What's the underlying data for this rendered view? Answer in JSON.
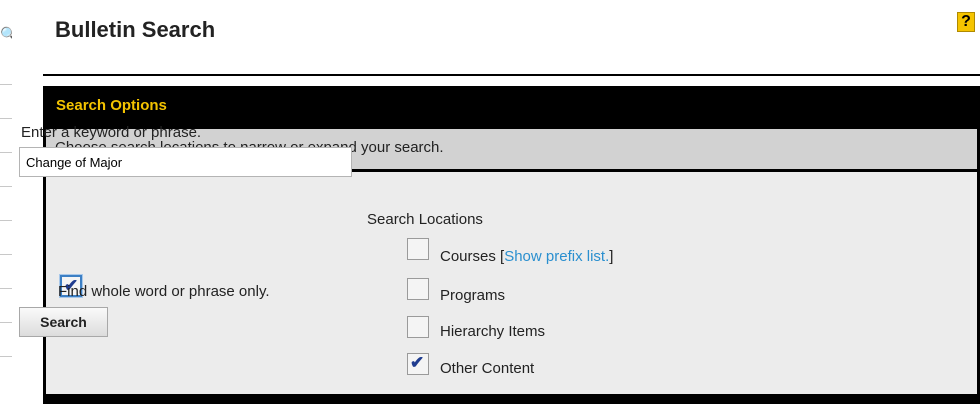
{
  "page": {
    "title": "Bulletin Search",
    "help_glyph": "?"
  },
  "left_strip": {
    "icon": "search-icon"
  },
  "search_options": {
    "header": "Search Options",
    "description": "Choose search locations to narrow or expand your search.",
    "keyword": {
      "label": "Enter a keyword or phrase.",
      "value": "Change of Major"
    },
    "whole_word": {
      "label": "Find whole word or phrase only.",
      "checked": true
    },
    "search_button": "Search",
    "locations": {
      "heading": "Search Locations",
      "courses_label": "Courses [",
      "show_prefix_link": "Show prefix list.",
      "courses_close": "]",
      "items": [
        {
          "label": "Courses",
          "checked": false
        },
        {
          "label": "Programs",
          "checked": false
        },
        {
          "label": "Hierarchy Items",
          "checked": false
        },
        {
          "label": "Other Content",
          "checked": true
        }
      ]
    }
  }
}
